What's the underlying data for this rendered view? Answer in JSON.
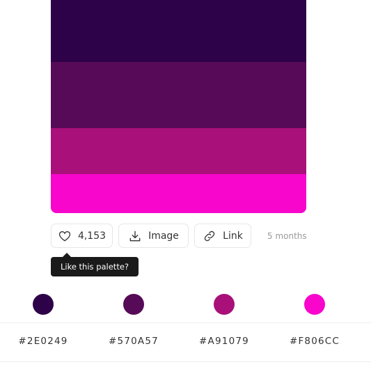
{
  "palette": {
    "colors": [
      "#2E0249",
      "#570A57",
      "#A91079",
      "#F806CC"
    ]
  },
  "actions": {
    "likes": "4,153",
    "image_label": "Image",
    "link_label": "Link",
    "time_ago": "5 months"
  },
  "tooltip": {
    "text": "Like this palette?"
  },
  "codes": [
    "#2E0249",
    "#570A57",
    "#A91079",
    "#F806CC"
  ]
}
